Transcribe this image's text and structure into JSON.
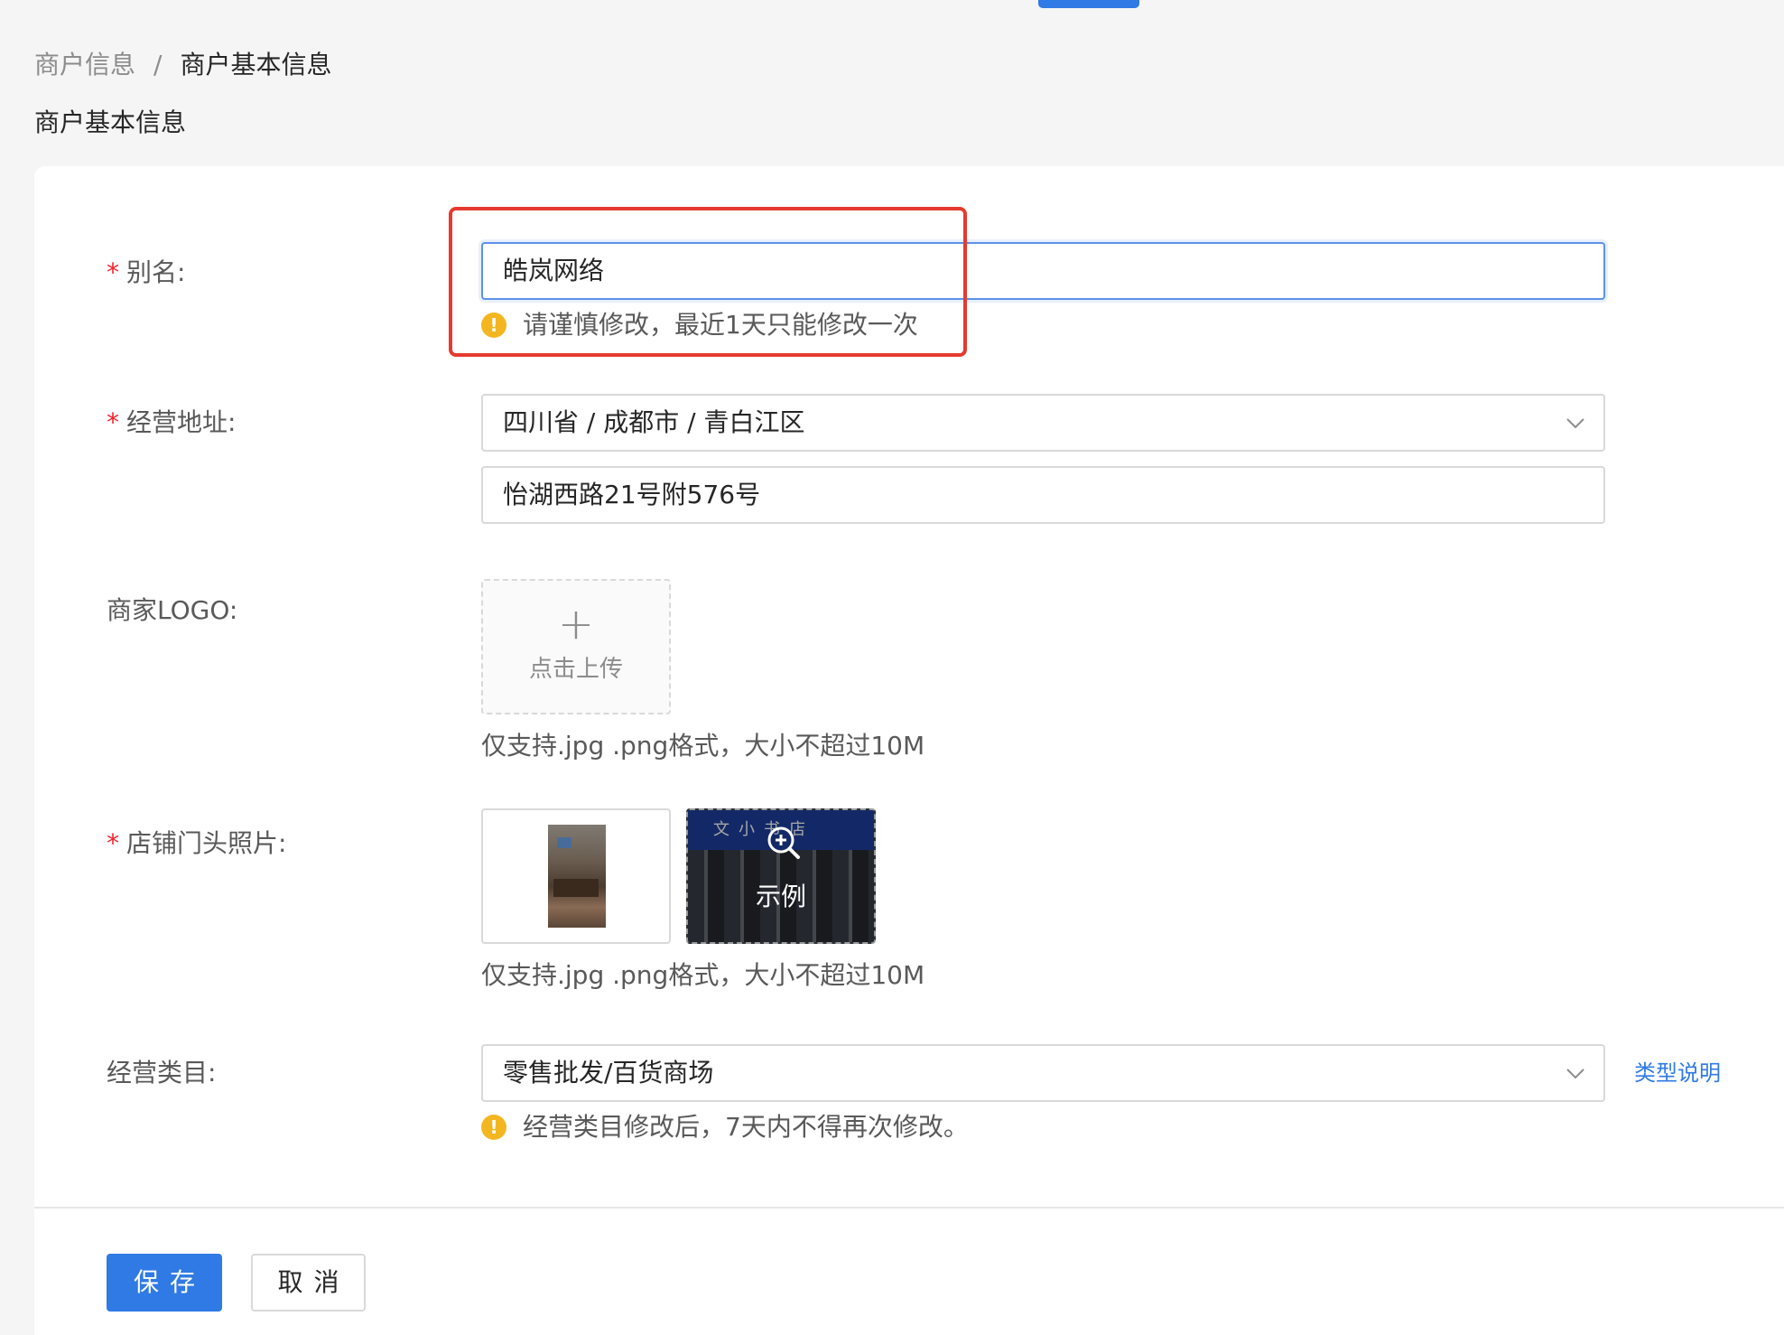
{
  "breadcrumb": {
    "parent": "商户信息",
    "separator": "/",
    "current": "商户基本信息"
  },
  "page_title": "商户基本信息",
  "form": {
    "alias": {
      "required_mark": "*",
      "label": "别名:",
      "value": "皓岚网络",
      "warning": "请谨慎修改，最近1天只能修改一次"
    },
    "address": {
      "required_mark": "*",
      "label": "经营地址:",
      "region_value": "四川省 / 成都市 / 青白江区",
      "detail_value": "怡湖西路21号附576号"
    },
    "logo": {
      "label": "商家LOGO:",
      "upload_plus": "+",
      "upload_text": "点击上传",
      "help": "仅支持.jpg .png格式，大小不超过10M"
    },
    "storefront": {
      "required_mark": "*",
      "label": "店铺门头照片:",
      "example_sign": "文小书店",
      "example_label": "示例",
      "help": "仅支持.jpg .png格式，大小不超过10M"
    },
    "category": {
      "label": "经营类目:",
      "value": "零售批发/百货商场",
      "link": "类型说明",
      "warning": "经营类目修改后，7天内不得再次修改。"
    }
  },
  "icons": {
    "warning": "warning-icon",
    "chevron": "chevron-down-icon",
    "zoom": "zoom-in-icon",
    "plus": "plus-icon"
  },
  "actions": {
    "save": "保存",
    "cancel": "取消"
  },
  "colors": {
    "primary": "#2f7ae5",
    "required": "#f5222d",
    "warning": "#f4b620",
    "highlight": "#e53a2f"
  }
}
